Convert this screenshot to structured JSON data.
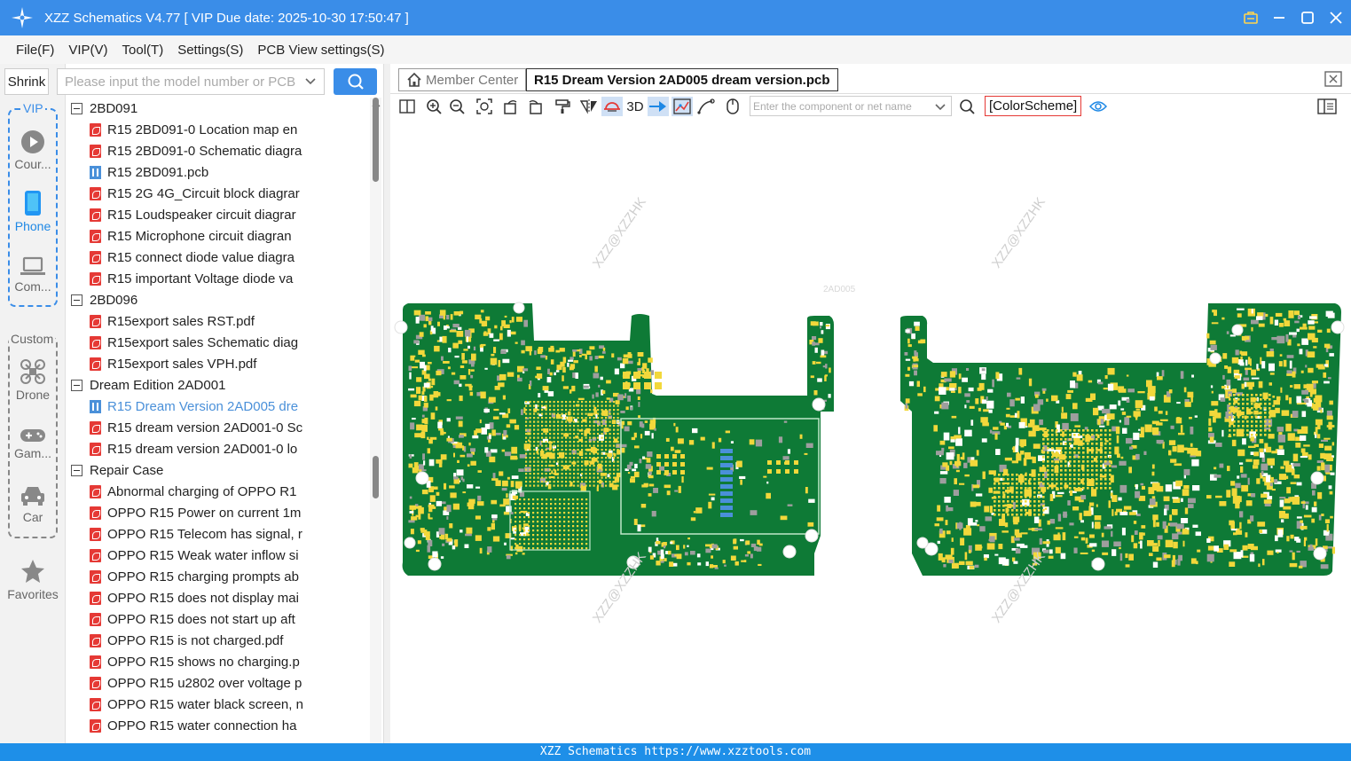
{
  "titlebar": {
    "title": "XZZ Schematics V4.77 [ VIP Due date: 2025-10-30 17:50:47 ]"
  },
  "menu": [
    "File(F)",
    "VIP(V)",
    "Tool(T)",
    "Settings(S)",
    "PCB View settings(S)"
  ],
  "left": {
    "shrink_label": "Shrink",
    "vip_label": "VIP",
    "custom_label": "Custom",
    "nav": [
      {
        "label": "Cour...",
        "icon": "play-circle-icon"
      },
      {
        "label": "Phone",
        "icon": "phone-icon",
        "active": true
      },
      {
        "label": "Com...",
        "icon": "laptop-icon"
      },
      {
        "label": "Drone",
        "icon": "drone-icon"
      },
      {
        "label": "Gam...",
        "icon": "gamepad-icon"
      },
      {
        "label": "Car",
        "icon": "car-icon"
      },
      {
        "label": "Favorites",
        "icon": "star-icon"
      }
    ]
  },
  "search": {
    "placeholder": "Please input the model number or PCB"
  },
  "tree": {
    "rows": [
      {
        "type": "folder",
        "label": "2BD091",
        "level": 0
      },
      {
        "type": "pdf",
        "label": "R15 2BD091-0 Location map en",
        "level": 1
      },
      {
        "type": "pdf",
        "label": "R15 2BD091-0 Schematic diagra",
        "level": 1
      },
      {
        "type": "pcb",
        "label": "R15 2BD091.pcb",
        "level": 1
      },
      {
        "type": "pdf",
        "label": "R15 2G 4G_Circuit block diagrar",
        "level": 1
      },
      {
        "type": "pdf",
        "label": "R15 Loudspeaker circuit diagrar",
        "level": 1
      },
      {
        "type": "pdf",
        "label": "R15 Microphone circuit diagran",
        "level": 1
      },
      {
        "type": "pdf",
        "label": "R15 connect diode value diagra",
        "level": 1
      },
      {
        "type": "pdf",
        "label": "R15 important Voltage diode va",
        "level": 1
      },
      {
        "type": "folder",
        "label": "2BD096",
        "level": 0
      },
      {
        "type": "pdf",
        "label": "R15export sales RST.pdf",
        "level": 1
      },
      {
        "type": "pdf",
        "label": "R15export sales Schematic diag",
        "level": 1
      },
      {
        "type": "pdf",
        "label": "R15export sales VPH.pdf",
        "level": 1
      },
      {
        "type": "folder",
        "label": "Dream Edition 2AD001",
        "level": 0
      },
      {
        "type": "pcb",
        "label": "R15 Dream Version 2AD005 dre",
        "level": 1,
        "selected": true
      },
      {
        "type": "pdf",
        "label": "R15 dream version 2AD001-0 Sc",
        "level": 1
      },
      {
        "type": "pdf",
        "label": "R15 dream version 2AD001-0 lo",
        "level": 1
      },
      {
        "type": "folder",
        "label": "Repair Case",
        "level": 0
      },
      {
        "type": "pdf",
        "label": "Abnormal charging of OPPO R1",
        "level": 1
      },
      {
        "type": "pdf",
        "label": "OPPO R15 Power on current 1m",
        "level": 1
      },
      {
        "type": "pdf",
        "label": "OPPO R15 Telecom has signal, r",
        "level": 1
      },
      {
        "type": "pdf",
        "label": "OPPO R15 Weak water inflow si",
        "level": 1
      },
      {
        "type": "pdf",
        "label": "OPPO R15 charging prompts ab",
        "level": 1
      },
      {
        "type": "pdf",
        "label": "OPPO R15 does not display mai",
        "level": 1
      },
      {
        "type": "pdf",
        "label": "OPPO R15 does not start up aft",
        "level": 1
      },
      {
        "type": "pdf",
        "label": "OPPO R15 is not charged.pdf",
        "level": 1
      },
      {
        "type": "pdf",
        "label": "OPPO R15 shows no charging.p",
        "level": 1
      },
      {
        "type": "pdf",
        "label": "OPPO R15 u2802 over voltage p",
        "level": 1
      },
      {
        "type": "pdf",
        "label": "OPPO R15 water black screen, n",
        "level": 1
      },
      {
        "type": "pdf",
        "label": "OPPO R15 water connection ha",
        "level": 1
      }
    ]
  },
  "tabs": {
    "member": "Member Center",
    "active": "R15 Dream Version 2AD005 dream version.pcb"
  },
  "toolbar": {
    "label_3d": "3D",
    "component_placeholder": "Enter the component or net name",
    "colorscheme": "[ColorScheme]"
  },
  "canvas": {
    "watermark": "XZZ@XZZHK",
    "board_label": "2AD005",
    "board_color": "#0e7a36",
    "pad_color": "#f2d83b"
  },
  "status": {
    "text": "XZZ Schematics https://www.xzztools.com"
  },
  "colors": {
    "accent": "#3a8de8",
    "statusbar": "#1e8fe8"
  }
}
